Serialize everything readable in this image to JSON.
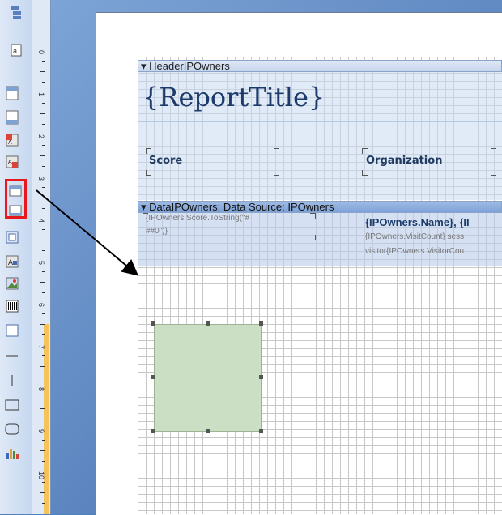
{
  "toolbar": {
    "tools": [
      {
        "name": "report-tree-icon"
      },
      {
        "name": "report-toggle-icon"
      },
      {
        "name": "page-header-icon"
      },
      {
        "name": "page-footer-icon"
      },
      {
        "name": "report-title-icon"
      },
      {
        "name": "report-summary-icon"
      },
      {
        "name": "header-band-icon"
      },
      {
        "name": "data-band-icon"
      },
      {
        "name": "panel-icon"
      },
      {
        "name": "text-component-icon"
      },
      {
        "name": "image-component-icon"
      },
      {
        "name": "barcode-component-icon"
      },
      {
        "name": "checkbox-component-icon"
      },
      {
        "name": "horizontal-line-icon"
      },
      {
        "name": "vertical-line-icon"
      },
      {
        "name": "rectangle-icon"
      },
      {
        "name": "rounded-rectangle-icon"
      },
      {
        "name": "chart-icon"
      }
    ]
  },
  "ruler": {
    "labels": [
      "0",
      "1",
      "2",
      "3",
      "4",
      "5",
      "6",
      "7",
      "8",
      "9",
      "10",
      "1"
    ]
  },
  "header_band": {
    "title": "▾ HeaderIPOwners"
  },
  "report_title": "{ReportTitle}",
  "columns": {
    "score": "Score",
    "organization": "Organization"
  },
  "data_band": {
    "title": "▾ DataIPOwners; Data Source: IPOwners"
  },
  "data_fields": {
    "score_expr_1": "{IPOwners.Score.ToString(\"#",
    "score_expr_2": "##0\")}",
    "name_expr": "{IPOwners.Name}, {II",
    "visit_expr_1": "{IPOwners.VisitCount} sess",
    "visit_expr_2": "visitor{IPOwners.VisitorCou"
  },
  "colors": {
    "highlight": "#e8191c",
    "shape_fill": "#cadfc3",
    "band": "#c6d6ed"
  }
}
